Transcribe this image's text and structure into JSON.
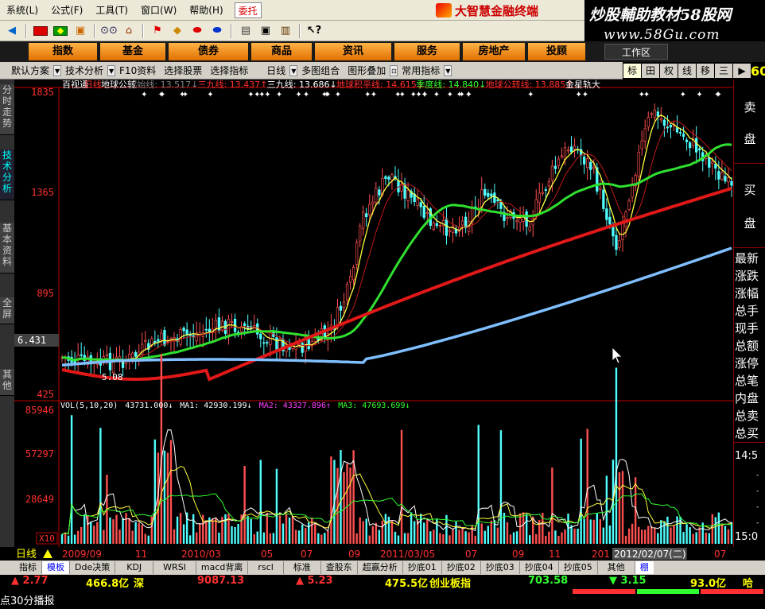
{
  "menu": {
    "items": [
      "系统(L)",
      "公式(F)",
      "工具(T)",
      "窗口(W)",
      "帮助(H)"
    ],
    "entrust": "委托"
  },
  "brand": {
    "title": "大智慧金融终端"
  },
  "watermark": {
    "line1": "炒股輔助教材58股网",
    "line2": "www.58Gu.com"
  },
  "categories": [
    "指数",
    "基金",
    "债券",
    "商品",
    "资讯",
    "服务",
    "房地产",
    "投顾"
  ],
  "workspace": "工作区",
  "toolrow": {
    "items": [
      "默认方案",
      "技术分析",
      "F10资料",
      "选择股票",
      "选择指标",
      "日线",
      "多图组合",
      "图形叠加",
      "常用指标"
    ],
    "right_buttons": [
      "标",
      "田",
      "权",
      "线",
      "移",
      "三",
      "▶"
    ],
    "right_number": "60"
  },
  "left_tabs": [
    "分时走势",
    "技术分析",
    "基本资料",
    "全屏",
    "其他"
  ],
  "price_panel": {
    "header": [
      {
        "text": "百视通",
        "color": "#ffffff"
      },
      {
        "text": "日线",
        "color": "#ff3030"
      },
      {
        "text": "地球公转",
        "color": "#ffffff"
      },
      {
        "text": "起始线: 13.517↓",
        "color": "#808080"
      },
      {
        "text": "三九线: 13.437↑",
        "color": "#ff3030"
      },
      {
        "text": "三九线: 13.686↓",
        "color": "#ffffff"
      },
      {
        "text": "地球积平线: 14.615↓",
        "color": "#ff3030"
      },
      {
        "text": "季度线: 14.840↓",
        "color": "#30ff30"
      },
      {
        "text": "地球公转线: 13.885↑",
        "color": "#ff3030"
      },
      {
        "text": "金星轨大",
        "color": "#ffffff"
      }
    ],
    "y_labels": [
      "1835",
      "1365",
      "895",
      "425"
    ],
    "cursor_value": "6.431",
    "low_mark": "5.08"
  },
  "volume_panel": {
    "header": [
      {
        "text": "VOL(5,10,20)",
        "color": "#ffffff"
      },
      {
        "text": "43731.000↓",
        "color": "#ffffff"
      },
      {
        "text": "MA1: 42930.199↓",
        "color": "#ffffff"
      },
      {
        "text": "MA2: 43327.896↑",
        "color": "#ff40ff"
      },
      {
        "text": "MA3: 47693.699↓",
        "color": "#30ff30"
      }
    ],
    "y_labels": [
      "85946",
      "57297",
      "28649"
    ],
    "unit": "X10"
  },
  "right_panel": {
    "sell": [
      "卖",
      "盘"
    ],
    "buy": [
      "买",
      "盘"
    ],
    "fields": [
      "最新",
      "涨跌",
      "涨幅",
      "总手",
      "现手",
      "总额",
      "涨停",
      "总笔",
      "内盘",
      "总卖",
      "总买"
    ],
    "time1": "14:5",
    "time2": "15:0"
  },
  "date_axis": {
    "period": "日线",
    "labels": [
      "2009/09",
      "11",
      "2010/03",
      "05",
      "07",
      "09",
      "2011/03/05",
      "07",
      "09",
      "11",
      "201",
      "2012/02/07(二)",
      "07"
    ]
  },
  "bottom_tabs": [
    "指标",
    "模板",
    "Dde决策",
    "KDJ",
    "WRSI",
    "macd背离",
    "rscl",
    "标准",
    "查股东",
    "超赢分析",
    "抄底01",
    "抄底02",
    "抄底03",
    "抄底04",
    "抄底05",
    "其他",
    "棚"
  ],
  "status": {
    "items": [
      {
        "text": "▲ 2.77",
        "color": "#ff3030"
      },
      {
        "text": "466.8亿",
        "color": "#ffff00"
      },
      {
        "text": "深",
        "color": "#ffff00"
      },
      {
        "text": "9087.13",
        "color": "#ff3030"
      },
      {
        "text": "▲ 5.23",
        "color": "#ff3030"
      },
      {
        "text": "475.5亿",
        "color": "#ffff00"
      },
      {
        "text": "创业板指",
        "color": "#ffff00"
      },
      {
        "text": "703.58",
        "color": "#30ff30"
      },
      {
        "text": "▼ 3.15",
        "color": "#30ff30"
      },
      {
        "text": "93.0亿",
        "color": "#ffff00"
      },
      {
        "text": "哈",
        "color": "#ffff00"
      }
    ],
    "ticker": "点30分播报"
  },
  "colors": {
    "ma_yellow": "#ffff40",
    "ma_green": "#30e030",
    "ma_red": "#e01818",
    "ma_blue": "#7fbfff",
    "up": "#ff5050",
    "down": "#50ffff"
  }
}
